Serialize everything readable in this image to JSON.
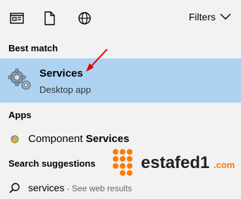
{
  "toolbar": {
    "filters_label": "Filters"
  },
  "sections": {
    "best_match": "Best match",
    "apps": "Apps",
    "search_suggestions": "Search suggestions"
  },
  "best_match": {
    "title": "Services",
    "subtitle": "Desktop app"
  },
  "apps": [
    {
      "prefix": "Component ",
      "bold": "Services"
    }
  ],
  "suggestions": [
    {
      "query": "services",
      "hint": " - See web results"
    }
  ],
  "watermark": {
    "text": "estafed1",
    "suffix": ".com"
  },
  "colors": {
    "highlight": "#aed3f2",
    "arrow": "#e00000",
    "brand": "#ff7a00"
  }
}
